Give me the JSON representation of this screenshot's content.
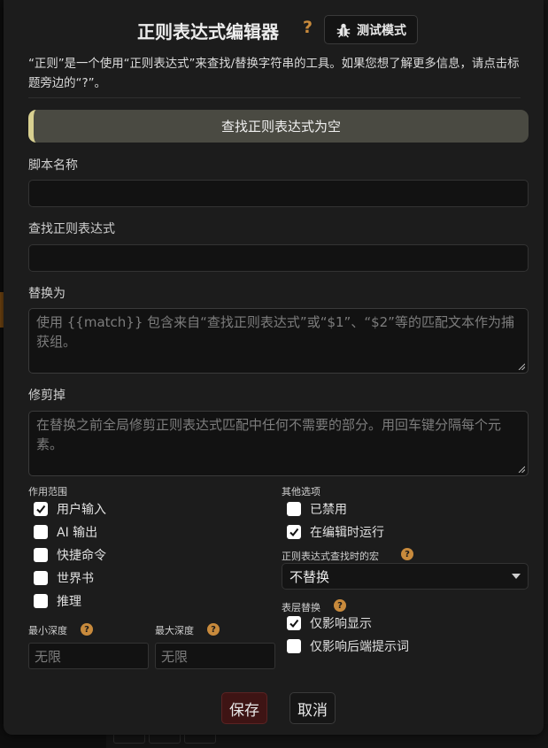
{
  "header": {
    "title": "正则表达式编辑器",
    "help": "?",
    "test_mode_label": "测试模式"
  },
  "description": "“正则”是一个使用“正则表达式”来查找/替换字符串的工具。如果您想了解更多信息，请点击标题旁边的“?”。",
  "banner": "查找正则表达式为空",
  "fields": {
    "script_name": {
      "label": "脚本名称",
      "value": ""
    },
    "find_regex": {
      "label": "查找正则表达式",
      "value": ""
    },
    "replace_with": {
      "label": "替换为",
      "placeholder": "使用 {{match}} 包含来自“查找正则表达式”或“$1”、“$2”等的匹配文本作为捕获组。"
    },
    "trim_out": {
      "label": "修剪掉",
      "placeholder": "在替换之前全局修剪正则表达式匹配中任何不需要的部分。用回车键分隔每个元素。"
    }
  },
  "scope": {
    "title": "作用范围",
    "items": [
      {
        "label": "用户输入",
        "checked": true
      },
      {
        "label": "AI 输出",
        "checked": false
      },
      {
        "label": "快捷命令",
        "checked": false
      },
      {
        "label": "世界书",
        "checked": false
      },
      {
        "label": "推理",
        "checked": false
      }
    ]
  },
  "depth": {
    "min_label": "最小深度",
    "max_label": "最大深度",
    "min_placeholder": "无限",
    "max_placeholder": "无限"
  },
  "other": {
    "title": "其他选项",
    "items": [
      {
        "label": "已禁用",
        "checked": false
      },
      {
        "label": "在编辑时运行",
        "checked": true
      }
    ]
  },
  "macro": {
    "title": "正则表达式查找时的宏",
    "selected": "不替换"
  },
  "layer": {
    "title": "表层替换",
    "items": [
      {
        "label": "仅影响显示",
        "checked": true
      },
      {
        "label": "仅影响后端提示词",
        "checked": false
      }
    ]
  },
  "actions": {
    "save_label": "保存",
    "cancel_label": "取消"
  },
  "colors": {
    "accent": "#c88a3c",
    "save_bg": "#3e1414",
    "banner_bg": "#4a4a42",
    "banner_edge": "#d8d090"
  }
}
